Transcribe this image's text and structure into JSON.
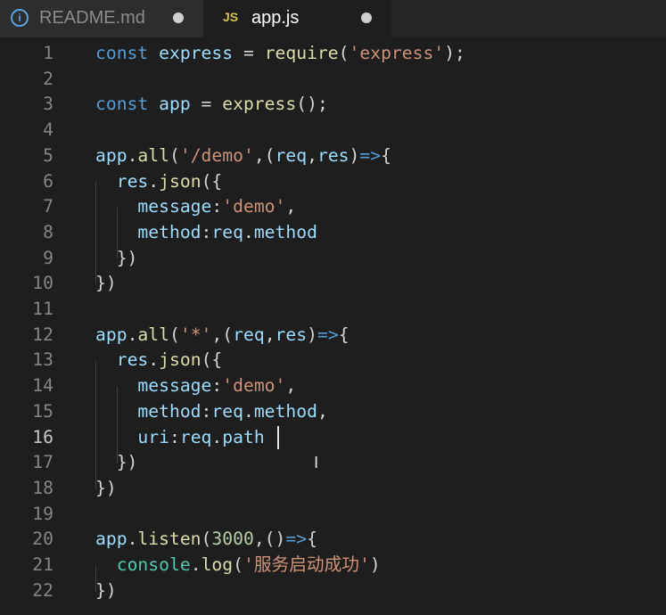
{
  "tabs": [
    {
      "label": "README.md",
      "icon": "info-icon",
      "active": false,
      "modified": true
    },
    {
      "label": "app.js",
      "icon_text": "JS",
      "active": true,
      "modified": true
    }
  ],
  "current_line": 16,
  "lines": [
    {
      "n": "1",
      "tokens": [
        [
          "kw",
          "const"
        ],
        [
          "pun",
          " "
        ],
        [
          "var",
          "express"
        ],
        [
          "pun",
          " = "
        ],
        [
          "fn",
          "require"
        ],
        [
          "pun",
          "("
        ],
        [
          "str",
          "'express'"
        ],
        [
          "pun",
          ");"
        ]
      ]
    },
    {
      "n": "2",
      "tokens": []
    },
    {
      "n": "3",
      "tokens": [
        [
          "kw",
          "const"
        ],
        [
          "pun",
          " "
        ],
        [
          "var",
          "app"
        ],
        [
          "pun",
          " = "
        ],
        [
          "fn",
          "express"
        ],
        [
          "pun",
          "();"
        ]
      ]
    },
    {
      "n": "4",
      "tokens": []
    },
    {
      "n": "5",
      "tokens": [
        [
          "var",
          "app"
        ],
        [
          "pun",
          "."
        ],
        [
          "fn",
          "all"
        ],
        [
          "pun",
          "("
        ],
        [
          "str",
          "'/demo'"
        ],
        [
          "pun",
          ",("
        ],
        [
          "var",
          "req"
        ],
        [
          "pun",
          ","
        ],
        [
          "var",
          "res"
        ],
        [
          "pun",
          ")"
        ],
        [
          "kw",
          "=>"
        ],
        [
          "pun",
          "{"
        ]
      ]
    },
    {
      "n": "6",
      "tokens": [
        [
          "pun",
          "  "
        ],
        [
          "var",
          "res"
        ],
        [
          "pun",
          "."
        ],
        [
          "fn",
          "json"
        ],
        [
          "pun",
          "({"
        ]
      ]
    },
    {
      "n": "7",
      "tokens": [
        [
          "pun",
          "    "
        ],
        [
          "var",
          "message"
        ],
        [
          "pun",
          ":"
        ],
        [
          "str",
          "'demo'"
        ],
        [
          "pun",
          ","
        ]
      ]
    },
    {
      "n": "8",
      "tokens": [
        [
          "pun",
          "    "
        ],
        [
          "var",
          "method"
        ],
        [
          "pun",
          ":"
        ],
        [
          "var",
          "req"
        ],
        [
          "pun",
          "."
        ],
        [
          "var",
          "method"
        ]
      ]
    },
    {
      "n": "9",
      "tokens": [
        [
          "pun",
          "  })"
        ]
      ]
    },
    {
      "n": "10",
      "tokens": [
        [
          "pun",
          "})"
        ]
      ]
    },
    {
      "n": "11",
      "tokens": []
    },
    {
      "n": "12",
      "tokens": [
        [
          "var",
          "app"
        ],
        [
          "pun",
          "."
        ],
        [
          "fn",
          "all"
        ],
        [
          "pun",
          "("
        ],
        [
          "str",
          "'*'"
        ],
        [
          "pun",
          ",("
        ],
        [
          "var",
          "req"
        ],
        [
          "pun",
          ","
        ],
        [
          "var",
          "res"
        ],
        [
          "pun",
          ")"
        ],
        [
          "kw",
          "=>"
        ],
        [
          "pun",
          "{"
        ]
      ]
    },
    {
      "n": "13",
      "tokens": [
        [
          "pun",
          "  "
        ],
        [
          "var",
          "res"
        ],
        [
          "pun",
          "."
        ],
        [
          "fn",
          "json"
        ],
        [
          "pun",
          "({"
        ]
      ]
    },
    {
      "n": "14",
      "tokens": [
        [
          "pun",
          "    "
        ],
        [
          "var",
          "message"
        ],
        [
          "pun",
          ":"
        ],
        [
          "str",
          "'demo'"
        ],
        [
          "pun",
          ","
        ]
      ]
    },
    {
      "n": "15",
      "tokens": [
        [
          "pun",
          "    "
        ],
        [
          "var",
          "method"
        ],
        [
          "pun",
          ":"
        ],
        [
          "var",
          "req"
        ],
        [
          "pun",
          "."
        ],
        [
          "var",
          "method"
        ],
        [
          "pun",
          ","
        ]
      ]
    },
    {
      "n": "16",
      "tokens": [
        [
          "pun",
          "    "
        ],
        [
          "var",
          "uri"
        ],
        [
          "pun",
          ":"
        ],
        [
          "var",
          "req"
        ],
        [
          "pun",
          "."
        ],
        [
          "var",
          "path"
        ]
      ]
    },
    {
      "n": "17",
      "tokens": [
        [
          "pun",
          "  })"
        ]
      ]
    },
    {
      "n": "18",
      "tokens": [
        [
          "pun",
          "})"
        ]
      ]
    },
    {
      "n": "19",
      "tokens": []
    },
    {
      "n": "20",
      "tokens": [
        [
          "var",
          "app"
        ],
        [
          "pun",
          "."
        ],
        [
          "fn",
          "listen"
        ],
        [
          "pun",
          "("
        ],
        [
          "num",
          "3000"
        ],
        [
          "pun",
          ",()"
        ],
        [
          "kw",
          "=>"
        ],
        [
          "pun",
          "{"
        ]
      ]
    },
    {
      "n": "21",
      "tokens": [
        [
          "pun",
          "  "
        ],
        [
          "cls",
          "console"
        ],
        [
          "pun",
          "."
        ],
        [
          "fn",
          "log"
        ],
        [
          "pun",
          "("
        ],
        [
          "str",
          "'服务启动成功'"
        ],
        [
          "pun",
          ")"
        ]
      ]
    },
    {
      "n": "22",
      "tokens": [
        [
          "pun",
          "})"
        ]
      ]
    }
  ]
}
